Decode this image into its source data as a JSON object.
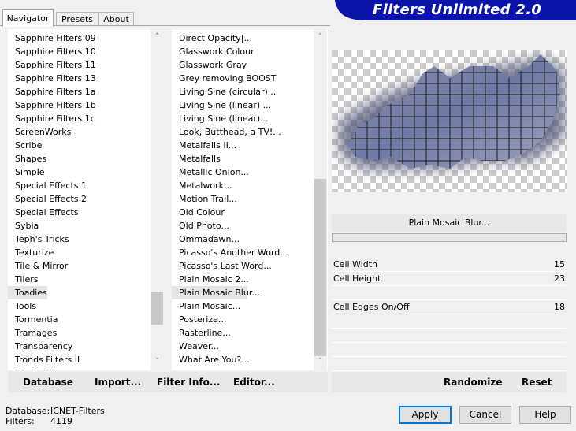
{
  "tabs": [
    "Navigator",
    "Presets",
    "About"
  ],
  "banner_title": "Filters Unlimited 2.0",
  "categories": [
    "Sapphire Filters 09",
    "Sapphire Filters 10",
    "Sapphire Filters 11",
    "Sapphire Filters 13",
    "Sapphire Filters 1a",
    "Sapphire Filters 1b",
    "Sapphire Filters 1c",
    "ScreenWorks",
    "Scribe",
    "Shapes",
    "Simple",
    "Special Effects 1",
    "Special Effects 2",
    "Special Effects",
    "Sybia",
    "Teph's Tricks",
    "Texturize",
    "Tile & Mirror",
    "Tilers",
    "Toadies",
    "Tools",
    "Tormentia",
    "Tramages",
    "Transparency",
    "Tronds Filters II",
    "Tronds Filters"
  ],
  "selected_category": "Toadies",
  "filters": [
    "Direct Opacity|...",
    "Glasswork Colour",
    "Glasswork Gray",
    "Grey removing BOOST",
    "Living Sine (circular)...",
    "Living Sine (linear) ...",
    "Living Sine (linear)...",
    "Look, Butthead, a TV!...",
    "Metalfalls II...",
    "Metalfalls",
    "Metallic Onion...",
    "Metalwork...",
    "Motion Trail...",
    "Old Colour",
    "Old Photo...",
    "Ommadawn...",
    "Picasso's Another Word...",
    "Picasso's Last Word...",
    "Plain Mosaic 2...",
    "Plain Mosaic Blur...",
    "Plain Mosaic...",
    "Posterize...",
    "Rasterline...",
    "Weaver...",
    "What Are You?..."
  ],
  "selected_filter": "Plain Mosaic Blur...",
  "left_buttons": [
    "Database",
    "Import...",
    "Filter Info...",
    "Editor..."
  ],
  "filter_title": "Plain Mosaic Blur...",
  "params": [
    {
      "label": "Cell Width",
      "value": "15"
    },
    {
      "label": "Cell Height",
      "value": "23"
    },
    {
      "label": "",
      "value": ""
    },
    {
      "label": "Cell Edges On/Off",
      "value": "18"
    }
  ],
  "right_buttons": [
    "Randomize",
    "Reset"
  ],
  "status": {
    "database_label": "Database:",
    "database_value": "ICNET-Filters",
    "filters_label": "Filters:",
    "filters_value": "4119"
  },
  "dialog_buttons": [
    "Apply",
    "Cancel",
    "Help"
  ],
  "colors": {
    "banner": "#0a14a8",
    "selection": "#e5e5e5",
    "mosaic": "#6e7aa6",
    "default_border": "#0078d7"
  }
}
